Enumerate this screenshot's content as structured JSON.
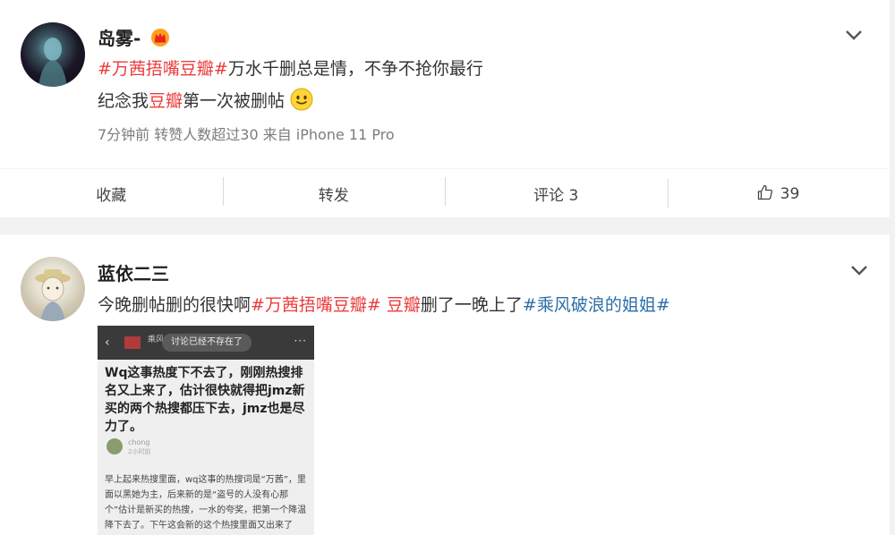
{
  "post1": {
    "username": "岛雾-",
    "line1": {
      "tag": "#万茜捂嘴豆瓣#",
      "rest": "万水千删总是情，不争不抢你最行"
    },
    "line2": {
      "before": "纪念我",
      "highlight": "豆瓣",
      "after": "第一次被删帖"
    },
    "meta": "7分钟前  转赞人数超过30  来自 iPhone 11 Pro"
  },
  "actions": {
    "favorite": "收藏",
    "repost": "转发",
    "comment": "评论 3",
    "like_count": "39"
  },
  "post2": {
    "username": "蓝依二三",
    "text": {
      "before": "今晚删帖删的很快啊",
      "tag1": "#万茜捂嘴豆瓣#",
      "highlight": " 豆瓣",
      "middle": "删了一晚上了",
      "tag2": "#乘风破浪的姐姐#"
    },
    "embedded": {
      "back": "‹",
      "title": "乘风",
      "toast": "讨论已经不存在了",
      "more": "···",
      "headline": "Wq这事热度下不去了，刚刚热搜排名又上来了，估计很快就得把jmz新买的两个热搜都压下去，jmz也是尽力了。",
      "author": "chong",
      "time": "2小时前",
      "body": "早上起来热搜里面，wq这事的热搜词是“万茜”，里面以黑她为主，后来新的是“盗号的人没有心那个”估计是新买的热搜，一水的夸奖，把第一个降温降下去了。下午这会新的这个热搜里面又出来了"
    }
  },
  "colors": {
    "tag_red": "#eb3b3b",
    "link_blue": "#2c6ea8",
    "meta_gray": "#7c7c7c"
  }
}
